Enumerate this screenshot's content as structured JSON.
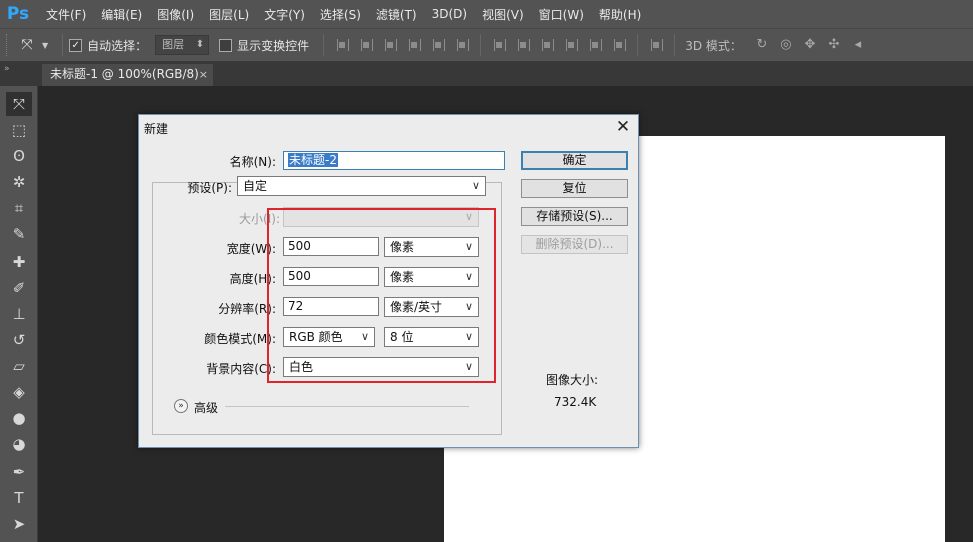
{
  "app": {
    "logo": "Ps"
  },
  "menu": [
    "文件(F)",
    "编辑(E)",
    "图像(I)",
    "图层(L)",
    "文字(Y)",
    "选择(S)",
    "滤镜(T)",
    "3D(D)",
    "视图(V)",
    "窗口(W)",
    "帮助(H)"
  ],
  "options": {
    "auto_select_label": "自动选择：",
    "auto_select_value": "图层",
    "show_transform_label": "显示变换控件",
    "mode_3d_label": "3D 模式："
  },
  "tab": {
    "title": "未标题-1 @ 100%(RGB/8)",
    "close": "×"
  },
  "dialog": {
    "title": "新建",
    "name_label": "名称(N):",
    "name_value": "未标题-2",
    "preset_label": "预设(P):",
    "preset_value": "自定",
    "size_label": "大小(I):",
    "width_label": "宽度(W):",
    "width_value": "500",
    "width_unit": "像素",
    "height_label": "高度(H):",
    "height_value": "500",
    "height_unit": "像素",
    "resolution_label": "分辨率(R):",
    "resolution_value": "72",
    "resolution_unit": "像素/英寸",
    "color_mode_label": "颜色模式(M):",
    "color_mode_value": "RGB 颜色",
    "bit_depth_value": "8 位",
    "background_label": "背景内容(C):",
    "background_value": "白色",
    "advanced_label": "高级",
    "ok_button": "确定",
    "reset_button": "复位",
    "save_preset_button": "存储预设(S)...",
    "delete_preset_button": "删除预设(D)...",
    "image_size_label": "图像大小:",
    "image_size_value": "732.4K"
  },
  "colors": {
    "ps_blue": "#31a8ff",
    "ui_gray": "#535353",
    "workspace": "#282828",
    "highlight_red": "#e0242e",
    "selection_blue": "#3a7cc9"
  }
}
